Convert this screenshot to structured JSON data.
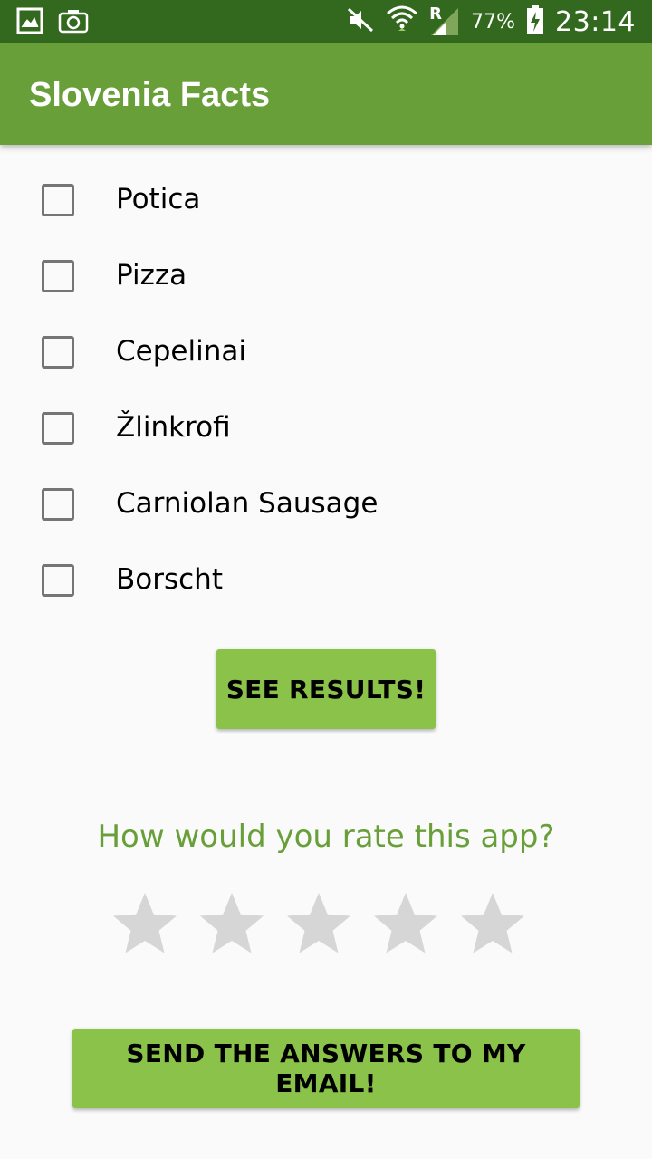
{
  "status_bar": {
    "battery_percent": "77%",
    "time": "23:14",
    "network_label": "R",
    "icons": [
      "gallery-icon",
      "camera-icon",
      "mute-icon",
      "wifi-icon",
      "signal-icon",
      "battery-charging-icon"
    ]
  },
  "app_bar": {
    "title": "Slovenia Facts",
    "color": "#689f38"
  },
  "checkboxes": [
    {
      "label": "Potica",
      "checked": false
    },
    {
      "label": "Pizza",
      "checked": false
    },
    {
      "label": "Cepelinai",
      "checked": false
    },
    {
      "label": "Žlinkrofi",
      "checked": false
    },
    {
      "label": "Carniolan Sausage",
      "checked": false
    },
    {
      "label": "Borscht",
      "checked": false
    }
  ],
  "results_button": {
    "label": "SEE RESULTS!"
  },
  "rating": {
    "question": "How would you rate this app?",
    "value": 0,
    "max": 5
  },
  "email_button": {
    "label": "SEND THE ANSWERS TO MY EMAIL!"
  },
  "colors": {
    "status_bar": "#33691e",
    "accent": "#8bc34a",
    "question_text": "#689f38",
    "star_empty": "#d6d6d6"
  }
}
